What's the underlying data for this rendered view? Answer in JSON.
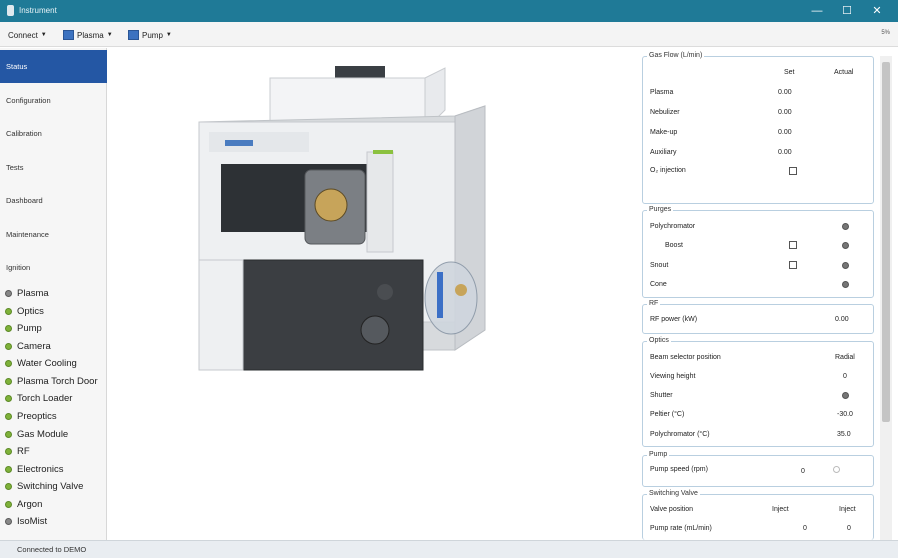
{
  "window": {
    "title": "Instrument",
    "minimize": "—",
    "maximize": "☐",
    "close": "✕"
  },
  "menubar": {
    "items": [
      {
        "label": "Connect",
        "icon": ""
      },
      {
        "label": "Plasma",
        "icon": "plasma-icon"
      },
      {
        "label": "Pump",
        "icon": "pump-icon"
      }
    ],
    "extra": "5%"
  },
  "sidebar": {
    "nav": [
      "Status",
      "Configuration",
      "Calibration",
      "Tests",
      "Dashboard",
      "Maintenance",
      "Ignition"
    ],
    "subsystems": [
      {
        "label": "Plasma",
        "state": "gray"
      },
      {
        "label": "Optics",
        "state": "green"
      },
      {
        "label": "Pump",
        "state": "green"
      },
      {
        "label": "Camera",
        "state": "green"
      },
      {
        "label": "Water Cooling",
        "state": "green"
      },
      {
        "label": "Plasma Torch Door",
        "state": "green"
      },
      {
        "label": "Torch Loader",
        "state": "green"
      },
      {
        "label": "Preoptics",
        "state": "green"
      },
      {
        "label": "Gas Module",
        "state": "green"
      },
      {
        "label": "RF",
        "state": "green"
      },
      {
        "label": "Electronics",
        "state": "green"
      },
      {
        "label": "Switching Valve",
        "state": "green"
      },
      {
        "label": "Argon",
        "state": "green"
      },
      {
        "label": "IsoMist",
        "state": "gray"
      }
    ]
  },
  "status_bar": "Connected to DEMO",
  "panel": {
    "gas_flow": {
      "title": "Gas Flow (L/min)",
      "col_set": "Set",
      "col_actual": "Actual",
      "rows": [
        {
          "label": "Plasma",
          "set": "0.00"
        },
        {
          "label": "Nebulizer",
          "set": "0.00"
        },
        {
          "label": "Make-up",
          "set": "0.00"
        },
        {
          "label": "Auxiliary",
          "set": "0.00"
        },
        {
          "label": "O₂ injection",
          "set": ""
        }
      ]
    },
    "purges": {
      "title": "Purges",
      "rows": [
        {
          "label": "Polychromator"
        },
        {
          "label": "Boost"
        },
        {
          "label": "Snout"
        },
        {
          "label": "Cone"
        }
      ]
    },
    "rf": {
      "title": "RF",
      "label": "RF power (kW)",
      "value": "0.00"
    },
    "optics": {
      "title": "Optics",
      "rows": [
        {
          "label": "Beam selector position",
          "value": "Radial"
        },
        {
          "label": "Viewing height",
          "value": "0"
        },
        {
          "label": "Shutter",
          "value": ""
        },
        {
          "label": "Peltier (°C)",
          "value": "-30.0"
        },
        {
          "label": "Polychromator (°C)",
          "value": "35.0"
        }
      ]
    },
    "pump": {
      "title": "Pump",
      "label": "Pump speed (rpm)",
      "value": "0"
    },
    "switching_valve": {
      "title": "Switching Valve",
      "rows": [
        {
          "label": "Valve position",
          "v1": "Inject",
          "v2": "Inject"
        },
        {
          "label": "Pump rate (mL/min)",
          "v1": "0",
          "v2": "0"
        }
      ]
    }
  }
}
